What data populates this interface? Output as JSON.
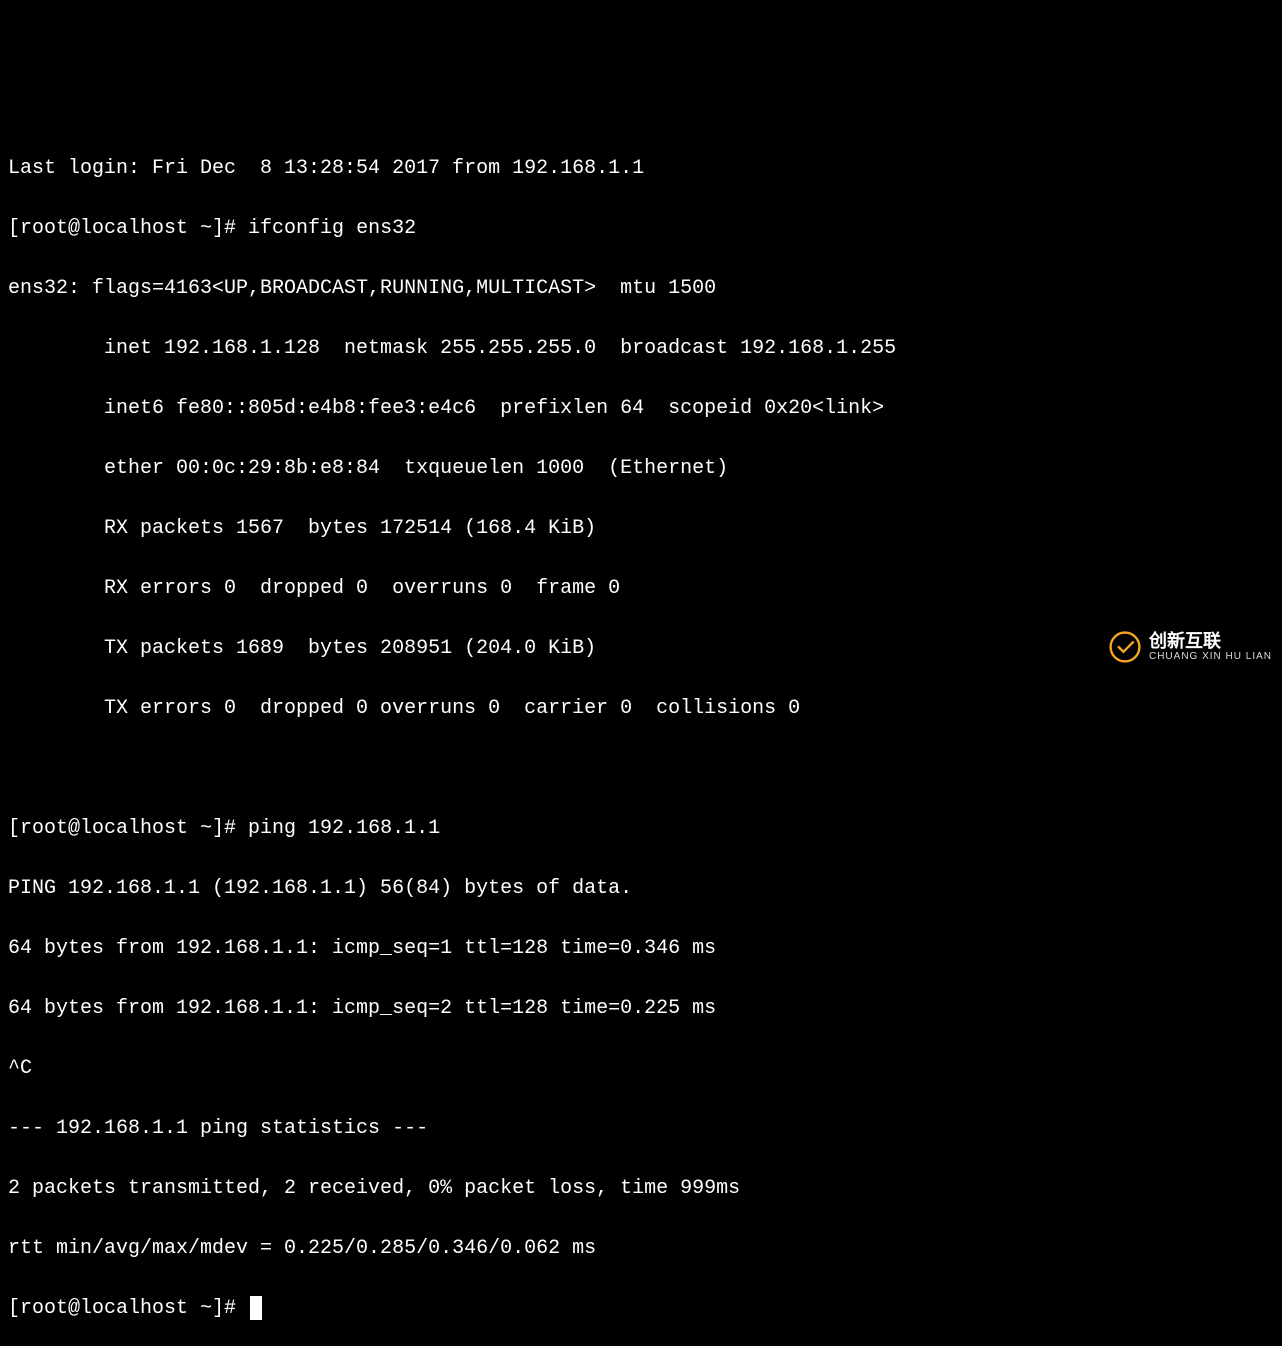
{
  "terminal": {
    "last_login": "Last login: Fri Dec  8 13:28:54 2017 from 192.168.1.1",
    "prompt1_prefix": "[root@localhost ~]# ",
    "command1": "ifconfig ens32",
    "ifconfig": {
      "line1": "ens32: flags=4163<UP,BROADCAST,RUNNING,MULTICAST>  mtu 1500",
      "line2": "        inet 192.168.1.128  netmask 255.255.255.0  broadcast 192.168.1.255",
      "line3": "        inet6 fe80::805d:e4b8:fee3:e4c6  prefixlen 64  scopeid 0x20<link>",
      "line4": "        ether 00:0c:29:8b:e8:84  txqueuelen 1000  (Ethernet)",
      "line5": "        RX packets 1567  bytes 172514 (168.4 KiB)",
      "line6": "        RX errors 0  dropped 0  overruns 0  frame 0",
      "line7": "        TX packets 1689  bytes 208951 (204.0 KiB)",
      "line8": "        TX errors 0  dropped 0 overruns 0  carrier 0  collisions 0"
    },
    "prompt2_prefix": "[root@localhost ~]# ",
    "command2": "ping 192.168.1.1",
    "ping": {
      "header": "PING 192.168.1.1 (192.168.1.1) 56(84) bytes of data.",
      "reply1": "64 bytes from 192.168.1.1: icmp_seq=1 ttl=128 time=0.346 ms",
      "reply2": "64 bytes from 192.168.1.1: icmp_seq=2 ttl=128 time=0.225 ms",
      "interrupt": "^C",
      "stats_header": "--- 192.168.1.1 ping statistics ---",
      "stats_line1": "2 packets transmitted, 2 received, 0% packet loss, time 999ms",
      "stats_line2": "rtt min/avg/max/mdev = 0.225/0.285/0.346/0.062 ms"
    },
    "prompt3_prefix": "[root@localhost ~]# "
  },
  "watermark": {
    "cn": "创新互联",
    "en": "CHUANG XIN HU LIAN"
  }
}
